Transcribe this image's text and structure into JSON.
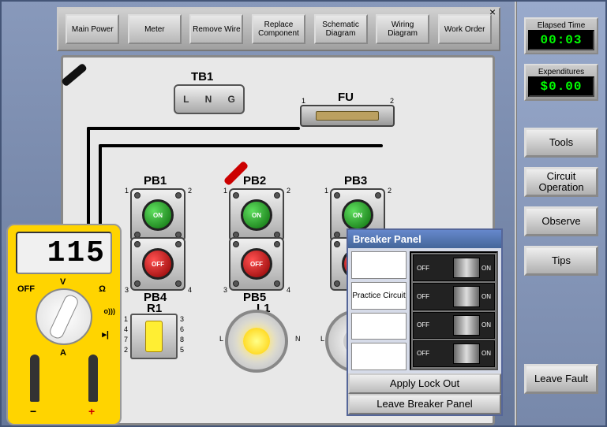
{
  "toolbar": {
    "buttons": [
      "Main Power",
      "Meter",
      "Remove Wire",
      "Replace Component",
      "Schematic Diagram",
      "Wiring Diagram",
      "Work Order"
    ]
  },
  "status": {
    "elapsed_label": "Elapsed Time",
    "elapsed_value": "00:03",
    "expend_label": "Expenditures",
    "expend_value": "$0.00"
  },
  "rail_buttons": [
    "Tools",
    "Circuit Operation",
    "Observe",
    "Tips",
    "Leave Fault"
  ],
  "components": {
    "tb1": {
      "label": "TB1",
      "terminals": [
        "L",
        "N",
        "G"
      ]
    },
    "fu": {
      "label": "FU",
      "pins": [
        "1",
        "2"
      ]
    },
    "pb1": {
      "label": "PB1",
      "text": "ON"
    },
    "pb2": {
      "label": "PB2",
      "text": "ON"
    },
    "pb3": {
      "label": "PB3",
      "text": "ON"
    },
    "pb4": {
      "label": "PB4",
      "text": "OFF"
    },
    "pb5": {
      "label": "PB5",
      "text": "OFF"
    },
    "r1": {
      "label": "R1"
    },
    "l1": {
      "label": "L1",
      "l": "L",
      "n": "N"
    },
    "l2": {
      "l": "L"
    }
  },
  "meter": {
    "reading": "115",
    "positions": {
      "off": "OFF",
      "v": "V",
      "ohm": "Ω",
      "sound": "o)))",
      "diode": "▸|",
      "a": "A"
    }
  },
  "breaker": {
    "title": "Breaker Panel",
    "labels": [
      "",
      "Practice Circuit",
      "",
      ""
    ],
    "switch_off": "OFF",
    "switch_on": "ON",
    "states": [
      "on",
      "on",
      "on",
      "on"
    ],
    "apply": "Apply Lock Out",
    "leave": "Leave Breaker Panel"
  }
}
